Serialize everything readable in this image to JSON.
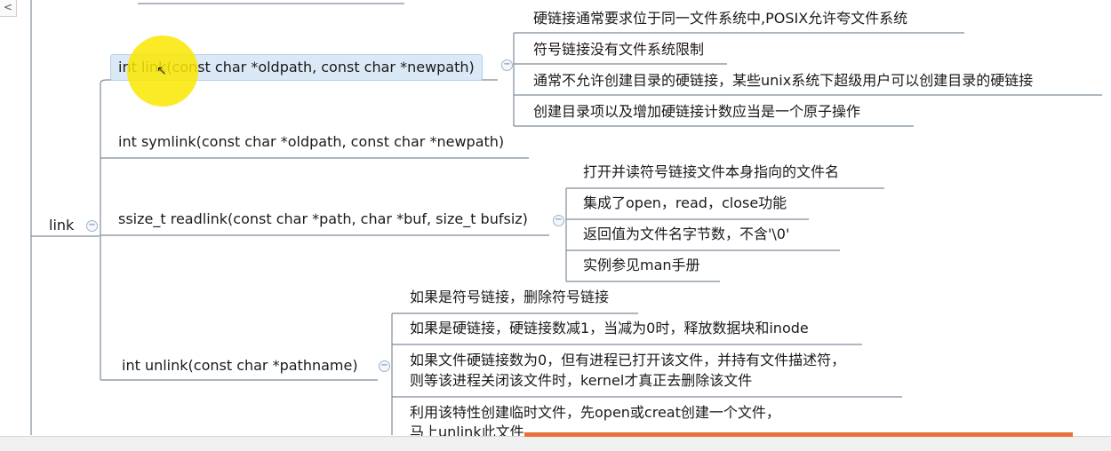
{
  "mindmap": {
    "root": {
      "label": "link"
    },
    "functions": [
      {
        "signature": "int link(const char *oldpath, const char *newpath)",
        "notes": [
          "硬链接通常要求位于同一文件系统中,POSIX允许夸文件系统",
          "符号链接没有文件系统限制",
          "通常不允许创建目录的硬链接，某些unix系统下超级用户可以创建目录的硬链接",
          "创建目录项以及增加硬链接计数应当是一个原子操作"
        ]
      },
      {
        "signature": "int symlink(const char *oldpath, const char *newpath)",
        "notes": []
      },
      {
        "signature": "ssize_t readlink(const char *path, char *buf, size_t bufsiz)",
        "notes": [
          "打开并读符号链接文件本身指向的文件名",
          "集成了open，read，close功能",
          "返回值为文件名字节数，不含'\\0'",
          "实例参见man手册"
        ]
      },
      {
        "signature": "int unlink(const char *pathname)",
        "notes": [
          "如果是符号链接，删除符号链接",
          "如果是硬链接，硬链接数减1，当减为0时，释放数据块和inode",
          "如果文件硬链接数为0，但有进程已打开该文件，并持有文件描述符，",
          "则等该进程关闭该文件时，kernel才真正去删除该文件",
          "利用该特性创建临时文件，先open或creat创建一个文件，",
          "马上unlink此文件"
        ]
      }
    ],
    "collapse_glyph": "−",
    "selected_index": 0
  },
  "ui": {
    "left_tab_glyph": "<",
    "progress_fraction": 0.5,
    "colors": {
      "line": "#7e8c99",
      "selected_bg": "#dbe8f6",
      "highlight": "#fae800",
      "progress": "#e8703a"
    }
  }
}
